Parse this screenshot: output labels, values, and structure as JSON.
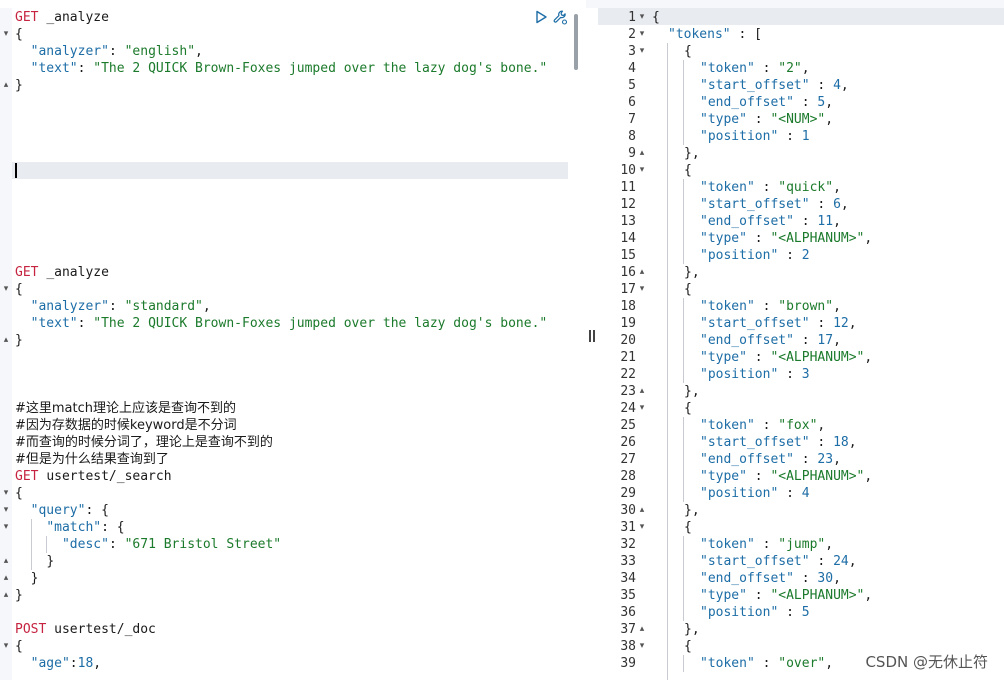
{
  "request_editor": {
    "blocks": [
      {
        "method": "GET",
        "url": "_analyze",
        "analyzer_key": "\"analyzer\"",
        "analyzer_val": "\"english\"",
        "text_key": "\"text\"",
        "text_val": "\"The 2 QUICK Brown-Foxes jumped over the lazy dog's bone.\""
      },
      {
        "method": "GET",
        "url": "_analyze",
        "analyzer_key": "\"analyzer\"",
        "analyzer_val": "\"standard\"",
        "text_key": "\"text\"",
        "text_val": "\"The 2 QUICK Brown-Foxes jumped over the lazy dog's bone.\""
      }
    ],
    "comments": [
      "#这里match理论上应该是查询不到的",
      "#因为存数据的时候keyword是不分词",
      "#而查询的时候分词了，理论上是查询不到的",
      "#但是为什么结果查询到了"
    ],
    "search": {
      "method": "GET",
      "url": "usertest/_search",
      "query_key": "\"query\"",
      "match_key": "\"match\"",
      "desc_key": "\"desc\"",
      "desc_val": "\"671 Bristol Street\""
    },
    "post": {
      "method": "POST",
      "url": "usertest/_doc",
      "age_key": "\"age\"",
      "age_val": "18"
    }
  },
  "response_viewer": {
    "tokens_key": "\"tokens\"",
    "tokens": [
      {
        "token": "\"2\"",
        "start_offset": "4",
        "end_offset": "5",
        "type": "\"<NUM>\"",
        "position": "1"
      },
      {
        "token": "\"quick\"",
        "start_offset": "6",
        "end_offset": "11",
        "type": "\"<ALPHANUM>\"",
        "position": "2"
      },
      {
        "token": "\"brown\"",
        "start_offset": "12",
        "end_offset": "17",
        "type": "\"<ALPHANUM>\"",
        "position": "3"
      },
      {
        "token": "\"fox\"",
        "start_offset": "18",
        "end_offset": "23",
        "type": "\"<ALPHANUM>\"",
        "position": "4"
      },
      {
        "token": "\"jump\"",
        "start_offset": "24",
        "end_offset": "30",
        "type": "\"<ALPHANUM>\"",
        "position": "5"
      },
      {
        "token": "\"over\""
      }
    ],
    "line_numbers": [
      "1",
      "2",
      "3",
      "4",
      "5",
      "6",
      "7",
      "8",
      "9",
      "10",
      "11",
      "12",
      "13",
      "14",
      "15",
      "16",
      "17",
      "18",
      "19",
      "20",
      "21",
      "22",
      "23",
      "24",
      "25",
      "26",
      "27",
      "28",
      "29",
      "30",
      "31",
      "32",
      "33",
      "34",
      "35",
      "36",
      "37",
      "38",
      "39"
    ]
  },
  "watermark": "CSDN @无休止符",
  "icons": {
    "run": "play-icon",
    "settings": "wrench-icon"
  }
}
